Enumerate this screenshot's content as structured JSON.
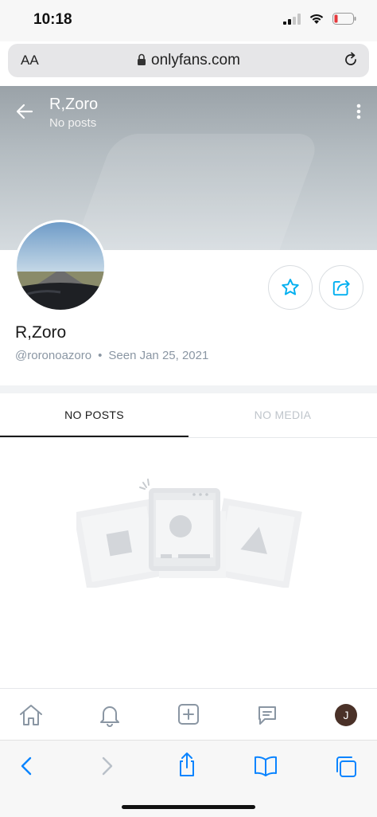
{
  "status_bar": {
    "time": "10:18"
  },
  "browser": {
    "text_size_label": "AA",
    "url": "onlyfans.com"
  },
  "header": {
    "name": "R,Zoro",
    "subtitle": "No posts"
  },
  "profile": {
    "name": "R,Zoro",
    "handle": "@roronoazoro",
    "seen_label": "Seen",
    "seen_date": "Jan 25, 2021"
  },
  "tabs": [
    {
      "label": "NO POSTS",
      "active": true
    },
    {
      "label": "NO MEDIA",
      "active": false
    }
  ],
  "nav": {
    "items": [
      "home-icon",
      "bell-icon",
      "plus-icon",
      "message-icon"
    ],
    "avatar_initial": "J"
  },
  "colors": {
    "accent": "#00aff0",
    "safari_blue": "#0a84ff",
    "muted": "#8a96a3"
  }
}
